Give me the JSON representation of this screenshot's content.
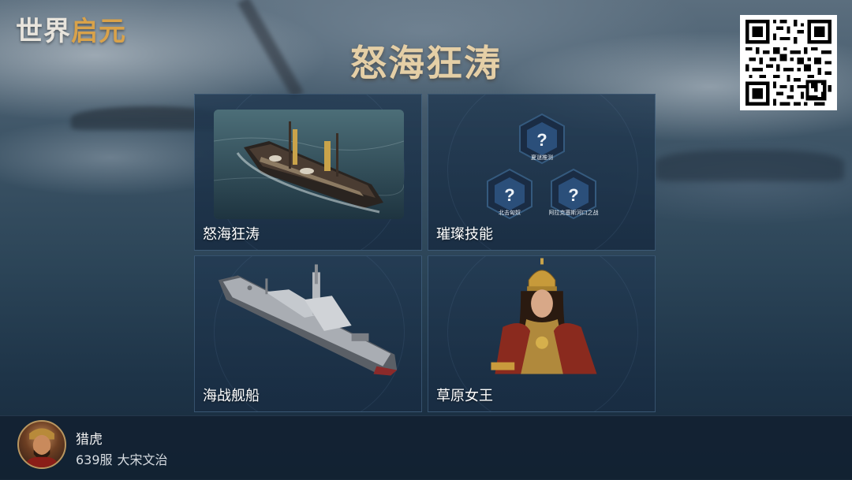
{
  "logo": {
    "part1": "世界",
    "part2": "启元"
  },
  "title": "怒海狂涛",
  "cards": [
    {
      "label": "怒海狂涛"
    },
    {
      "label": "璀璨技能",
      "skills": [
        {
          "symbol": "?",
          "caption": "夏谜推测"
        },
        {
          "symbol": "?",
          "caption": "北击匈奴"
        },
        {
          "symbol": "?",
          "caption": "阿拉克塞斯河口之战"
        }
      ]
    },
    {
      "label": "海战舰船"
    },
    {
      "label": "草原女王"
    }
  ],
  "user": {
    "name": "猎虎",
    "server": "639服",
    "civilization": "大宋文治"
  },
  "colors": {
    "title_gold": "#e5cfa6",
    "logo_gold": "#d9a24a",
    "card_bg": "#223a52"
  },
  "icons": [
    "qr-code",
    "question-hex-icon"
  ]
}
